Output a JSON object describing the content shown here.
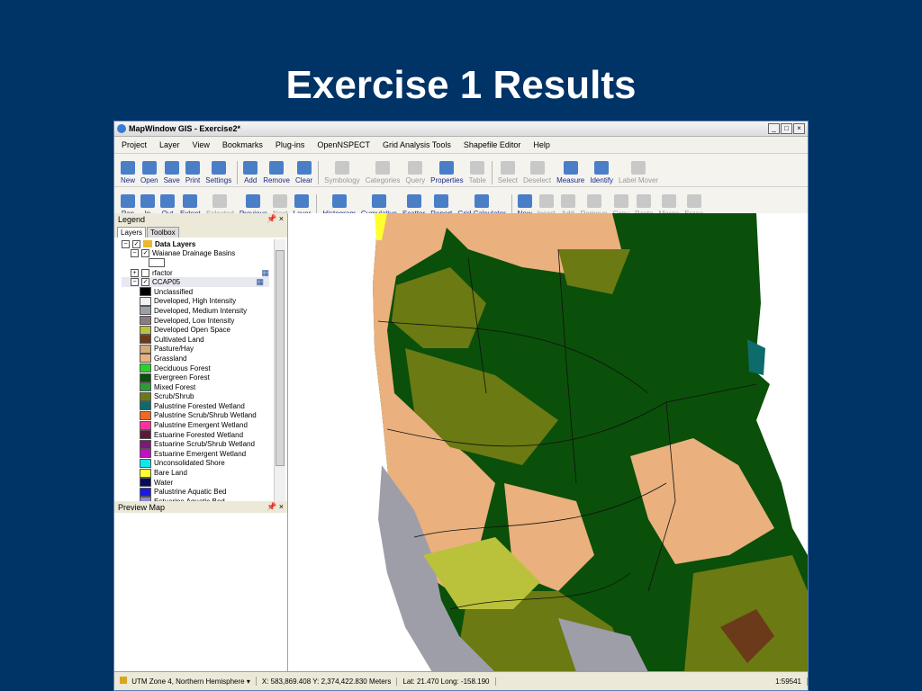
{
  "slide": {
    "title": "Exercise 1 Results"
  },
  "window": {
    "title": "MapWindow GIS - Exercise2*"
  },
  "menu": [
    "Project",
    "Layer",
    "View",
    "Bookmarks",
    "Plug-ins",
    "OpenNSPECT",
    "Grid Analysis Tools",
    "Shapefile Editor",
    "Help"
  ],
  "toolbar1": {
    "buttons": [
      {
        "label": "New",
        "icon": "new-icon",
        "enabled": true
      },
      {
        "label": "Open",
        "icon": "open-icon",
        "enabled": true
      },
      {
        "label": "Save",
        "icon": "save-icon",
        "enabled": true
      },
      {
        "label": "Print",
        "icon": "print-icon",
        "enabled": true
      },
      {
        "label": "Settings",
        "icon": "settings-icon",
        "enabled": true
      },
      {
        "label": "Add",
        "icon": "add-layer-icon",
        "enabled": true
      },
      {
        "label": "Remove",
        "icon": "remove-layer-icon",
        "enabled": true
      },
      {
        "label": "Clear",
        "icon": "clear-icon",
        "enabled": true
      },
      {
        "label": "Symbology",
        "icon": "symbology-icon",
        "enabled": false
      },
      {
        "label": "Categories",
        "icon": "categories-icon",
        "enabled": false
      },
      {
        "label": "Query",
        "icon": "query-icon",
        "enabled": false
      },
      {
        "label": "Properties",
        "icon": "properties-icon",
        "enabled": true
      },
      {
        "label": "Table",
        "icon": "table-icon",
        "enabled": false
      },
      {
        "label": "Select",
        "icon": "select-icon",
        "enabled": false
      },
      {
        "label": "Deselect",
        "icon": "deselect-icon",
        "enabled": false
      },
      {
        "label": "Measure",
        "icon": "measure-icon",
        "enabled": true
      },
      {
        "label": "Identify",
        "icon": "identify-icon",
        "enabled": true
      },
      {
        "label": "Label Mover",
        "icon": "label-mover-icon",
        "enabled": false
      }
    ]
  },
  "toolbar2": {
    "buttons": [
      {
        "label": "Pan",
        "icon": "pan-icon",
        "enabled": true
      },
      {
        "label": "In",
        "icon": "zoom-in-icon",
        "enabled": true
      },
      {
        "label": "Out",
        "icon": "zoom-out-icon",
        "enabled": true
      },
      {
        "label": "Extent",
        "icon": "extent-icon",
        "enabled": true
      },
      {
        "label": "Selected",
        "icon": "zoom-selected-icon",
        "enabled": false
      },
      {
        "label": "Previous",
        "icon": "previous-icon",
        "enabled": true
      },
      {
        "label": "Next",
        "icon": "next-icon",
        "enabled": false
      },
      {
        "label": "Layer",
        "icon": "zoom-layer-icon",
        "enabled": true
      },
      {
        "label": "Histogram",
        "icon": "histogram-icon",
        "enabled": true
      },
      {
        "label": "Cumulative",
        "icon": "cumulative-icon",
        "enabled": true
      },
      {
        "label": "Scatter",
        "icon": "scatter-icon",
        "enabled": true
      },
      {
        "label": "Report",
        "icon": "report-icon",
        "enabled": true
      },
      {
        "label": "Grid Calculator",
        "icon": "grid-calculator-icon",
        "enabled": true
      },
      {
        "label": "New",
        "icon": "new-shape-icon",
        "enabled": true
      },
      {
        "label": "Insert",
        "icon": "insert-icon",
        "enabled": false
      },
      {
        "label": "Add",
        "icon": "add-shp-icon",
        "enabled": false
      },
      {
        "label": "Remove",
        "icon": "remove-shp-icon",
        "enabled": false
      },
      {
        "label": "Copy",
        "icon": "copy-icon",
        "enabled": false
      },
      {
        "label": "Paste",
        "icon": "paste-icon",
        "enabled": false
      },
      {
        "label": "Merge",
        "icon": "merge-icon",
        "enabled": false
      },
      {
        "label": "Erase",
        "icon": "erase-icon",
        "enabled": false
      }
    ]
  },
  "legend": {
    "title": "Legend",
    "tabs": [
      "Layers",
      "Toolbox"
    ],
    "group": "Data Layers",
    "layers": [
      "Waianae Drainage Basins",
      "rfactor",
      "CCAP05"
    ],
    "categories": [
      {
        "label": "Unclassified",
        "color": "#000000"
      },
      {
        "label": "Developed, High Intensity",
        "color": "#f0f0f0"
      },
      {
        "label": "Developed, Medium Intensity",
        "color": "#9e9ea8"
      },
      {
        "label": "Developed, Low Intensity",
        "color": "#8c7a86"
      },
      {
        "label": "Developed Open Space",
        "color": "#b9c23a"
      },
      {
        "label": "Cultivated Land",
        "color": "#6b3a1a"
      },
      {
        "label": "Pasture/Hay",
        "color": "#d2aa7a"
      },
      {
        "label": "Grassland",
        "color": "#eab07e"
      },
      {
        "label": "Deciduous Forest",
        "color": "#28d228"
      },
      {
        "label": "Evergreen Forest",
        "color": "#0a4f0a"
      },
      {
        "label": "Mixed Forest",
        "color": "#2e9a3a"
      },
      {
        "label": "Scrub/Shrub",
        "color": "#6b7a12"
      },
      {
        "label": "Palustrine Forested Wetland",
        "color": "#0d6b6b"
      },
      {
        "label": "Palustrine Scrub/Shrub Wetland",
        "color": "#ee6a20"
      },
      {
        "label": "Palustrine Emergent Wetland",
        "color": "#ff3399"
      },
      {
        "label": "Estuarine Forested Wetland",
        "color": "#5a1a3a"
      },
      {
        "label": "Estuarine Scrub/Shrub Wetland",
        "color": "#7a1a7a"
      },
      {
        "label": "Estuarine Emergent Wetland",
        "color": "#c010c0"
      },
      {
        "label": "Unconsolidated Shore",
        "color": "#10e8e8"
      },
      {
        "label": "Bare Land",
        "color": "#ffff30"
      },
      {
        "label": "Water",
        "color": "#0a0a5a"
      },
      {
        "label": "Palustrine Aquatic Bed",
        "color": "#1a1ae0"
      },
      {
        "label": "Estuarine Aquatic Bed",
        "color": "#8a8ad0"
      }
    ]
  },
  "preview": {
    "title": "Preview Map"
  },
  "status": {
    "projection": "UTM Zone 4, Northern Hemisphere",
    "coords": "X: 583,869.408 Y: 2,374,422.830 Meters",
    "latlong": "Lat: 21.470 Long: -158.190",
    "scale": "1:59541"
  },
  "colors": {
    "slide_bg": "#003366"
  }
}
